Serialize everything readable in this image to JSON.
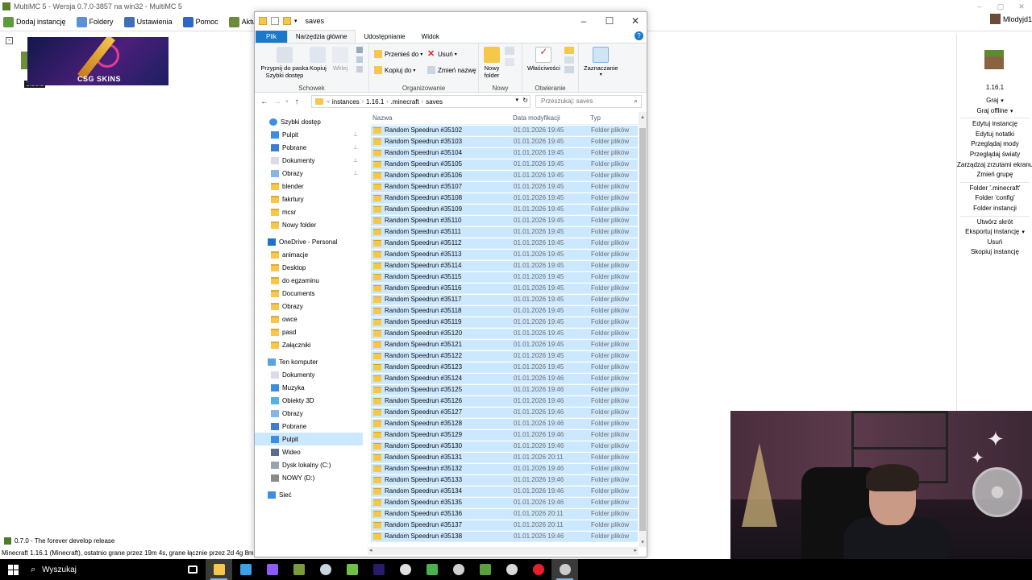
{
  "mmc": {
    "title": "MultiMC 5 - Wersja 0.7.0-3857 na win32 - MultiMC 5",
    "toolbar": [
      {
        "label": "Dodaj instancję",
        "icon": "add-instance-icon",
        "color": "#5c9a3c"
      },
      {
        "label": "Foldery",
        "icon": "folders-icon",
        "color": "#5b8fd6"
      },
      {
        "label": "Ustawienia",
        "icon": "settings-icon",
        "color": "#3f6fb5"
      },
      {
        "label": "Pomoc",
        "icon": "help-icon",
        "color": "#2f67c8"
      },
      {
        "label": "Aktualizuj",
        "icon": "update-icon",
        "color": "#6b8a3a"
      }
    ],
    "user": "Mlodyjd1",
    "instance_label": "1.16.1",
    "banner_text": "CSG SKINS",
    "right_panel": {
      "version": "1.16.1",
      "actions_top": [
        {
          "label": "Graj",
          "dropdown": true
        },
        {
          "label": "Graj offline",
          "dropdown": true
        }
      ],
      "actions_mid": [
        "Edytuj instancję",
        "Edytuj notatki",
        "Przeglądaj mody",
        "Przeglądaj światy",
        "Zarządzaj zrzutami ekranu",
        "Zmień grupę"
      ],
      "actions_folders": [
        "Folder '.minecraft'",
        "Folder 'config'",
        "Folder instancji"
      ],
      "actions_bottom": [
        {
          "label": "Utwórz skrót",
          "dropdown": false
        },
        {
          "label": "Eksportuj instancję",
          "dropdown": true
        },
        {
          "label": "Usuń",
          "dropdown": false
        },
        {
          "label": "Skopiuj instancję",
          "dropdown": false
        }
      ]
    },
    "news": "0.7.0 - The forever develop release",
    "status": "Minecraft 1.16.1 (Minecraft), ostatnio grane przez 19m 4s, grane łącznie przez 2d 4g 8m"
  },
  "explorer": {
    "title": "saves",
    "tabs": [
      "Plik",
      "Narzędzia główne",
      "Udostępnianie",
      "Widok"
    ],
    "ribbon": {
      "schowek": {
        "label": "Schowek",
        "pin": "Przypnij do paska Szybki dostęp",
        "copy": "Kopiuj",
        "paste": "Wklej"
      },
      "organizowanie": {
        "label": "Organizowanie",
        "move": "Przenieś do",
        "copy_to": "Kopiuj do",
        "delete": "Usuń",
        "rename": "Zmień nazwę"
      },
      "nowy": {
        "label": "Nowy",
        "new_folder": "Nowy folder"
      },
      "otwieranie": {
        "label": "Otwieranie",
        "properties": "Właściwości"
      },
      "zaznaczanie": {
        "label": "Zaznaczanie"
      }
    },
    "address": {
      "crumbs": [
        "instances",
        "1.16.1",
        ".minecraft",
        "saves"
      ],
      "search_placeholder": "Przeszukaj: saves"
    },
    "nav": {
      "quick_access": "Szybki dostęp",
      "quick_items": [
        {
          "label": "Pulpit",
          "pinned": true,
          "icon": "desktop"
        },
        {
          "label": "Pobrane",
          "pinned": true,
          "icon": "download"
        },
        {
          "label": "Dokumenty",
          "pinned": true,
          "icon": "docs"
        },
        {
          "label": "Obrazy",
          "pinned": true,
          "icon": "pictures"
        },
        {
          "label": "blender",
          "pinned": false,
          "icon": "folder"
        },
        {
          "label": "fakrtury",
          "pinned": false,
          "icon": "folder"
        },
        {
          "label": "mcsr",
          "pinned": false,
          "icon": "folder"
        },
        {
          "label": "Nowy folder",
          "pinned": false,
          "icon": "folder"
        }
      ],
      "onedrive": "OneDrive - Personal",
      "onedrive_items": [
        "animacje",
        "Desktop",
        "do egzaminu",
        "Documents",
        "Obrazy",
        "owce",
        "pasd",
        "Załączniki"
      ],
      "this_pc": "Ten komputer",
      "pc_items": [
        {
          "label": "Dokumenty",
          "icon": "docs",
          "selected": false
        },
        {
          "label": "Muzyka",
          "icon": "music",
          "selected": false
        },
        {
          "label": "Obiekty 3D",
          "icon": "objects3d",
          "selected": false
        },
        {
          "label": "Obrazy",
          "icon": "pictures",
          "selected": false
        },
        {
          "label": "Pobrane",
          "icon": "download",
          "selected": false
        },
        {
          "label": "Pulpit",
          "icon": "desktop",
          "selected": true
        },
        {
          "label": "Wideo",
          "icon": "video",
          "selected": false
        },
        {
          "label": "Dysk lokalny (C:)",
          "icon": "drive",
          "selected": false
        },
        {
          "label": "NOWY (D:)",
          "icon": "usb",
          "selected": false
        }
      ],
      "network": "Sieć"
    },
    "columns": {
      "name": "Nazwa",
      "date": "Data modyfikacji",
      "type": "Typ"
    },
    "files": [
      {
        "name": "Random Speedrun #35102",
        "date": "01.01.2026 19:45",
        "type": "Folder plików"
      },
      {
        "name": "Random Speedrun #35103",
        "date": "01.01.2026 19:45",
        "type": "Folder plików"
      },
      {
        "name": "Random Speedrun #35104",
        "date": "01.01.2026 19:45",
        "type": "Folder plików"
      },
      {
        "name": "Random Speedrun #35105",
        "date": "01.01.2026 19:45",
        "type": "Folder plików"
      },
      {
        "name": "Random Speedrun #35106",
        "date": "01.01.2026 19:45",
        "type": "Folder plików"
      },
      {
        "name": "Random Speedrun #35107",
        "date": "01.01.2026 19:45",
        "type": "Folder plików"
      },
      {
        "name": "Random Speedrun #35108",
        "date": "01.01.2026 19:45",
        "type": "Folder plików"
      },
      {
        "name": "Random Speedrun #35109",
        "date": "01.01.2026 19:45",
        "type": "Folder plików"
      },
      {
        "name": "Random Speedrun #35110",
        "date": "01.01.2026 19:45",
        "type": "Folder plików"
      },
      {
        "name": "Random Speedrun #35111",
        "date": "01.01.2026 19:45",
        "type": "Folder plików"
      },
      {
        "name": "Random Speedrun #35112",
        "date": "01.01.2026 19:45",
        "type": "Folder plików"
      },
      {
        "name": "Random Speedrun #35113",
        "date": "01.01.2026 19:45",
        "type": "Folder plików"
      },
      {
        "name": "Random Speedrun #35114",
        "date": "01.01.2026 19:45",
        "type": "Folder plików"
      },
      {
        "name": "Random Speedrun #35115",
        "date": "01.01.2026 19:45",
        "type": "Folder plików"
      },
      {
        "name": "Random Speedrun #35116",
        "date": "01.01.2026 19:45",
        "type": "Folder plików"
      },
      {
        "name": "Random Speedrun #35117",
        "date": "01.01.2026 19:45",
        "type": "Folder plików"
      },
      {
        "name": "Random Speedrun #35118",
        "date": "01.01.2026 19:45",
        "type": "Folder plików"
      },
      {
        "name": "Random Speedrun #35119",
        "date": "01.01.2026 19:45",
        "type": "Folder plików"
      },
      {
        "name": "Random Speedrun #35120",
        "date": "01.01.2026 19:45",
        "type": "Folder plików"
      },
      {
        "name": "Random Speedrun #35121",
        "date": "01.01.2026 19:45",
        "type": "Folder plików"
      },
      {
        "name": "Random Speedrun #35122",
        "date": "01.01.2026 19:45",
        "type": "Folder plików"
      },
      {
        "name": "Random Speedrun #35123",
        "date": "01.01.2026 19:45",
        "type": "Folder plików"
      },
      {
        "name": "Random Speedrun #35124",
        "date": "01.01.2026 19:46",
        "type": "Folder plików"
      },
      {
        "name": "Random Speedrun #35125",
        "date": "01.01.2026 19:46",
        "type": "Folder plików"
      },
      {
        "name": "Random Speedrun #35126",
        "date": "01.01.2026 19:46",
        "type": "Folder plików"
      },
      {
        "name": "Random Speedrun #35127",
        "date": "01.01.2026 19:46",
        "type": "Folder plików"
      },
      {
        "name": "Random Speedrun #35128",
        "date": "01.01.2026 19:46",
        "type": "Folder plików"
      },
      {
        "name": "Random Speedrun #35129",
        "date": "01.01.2026 19:46",
        "type": "Folder plików"
      },
      {
        "name": "Random Speedrun #35130",
        "date": "01.01.2026 19:46",
        "type": "Folder plików"
      },
      {
        "name": "Random Speedrun #35131",
        "date": "01.01.2026 20:11",
        "type": "Folder plików"
      },
      {
        "name": "Random Speedrun #35132",
        "date": "01.01.2026 19:46",
        "type": "Folder plików"
      },
      {
        "name": "Random Speedrun #35133",
        "date": "01.01.2026 19:46",
        "type": "Folder plików"
      },
      {
        "name": "Random Speedrun #35134",
        "date": "01.01.2026 19:46",
        "type": "Folder plików"
      },
      {
        "name": "Random Speedrun #35135",
        "date": "01.01.2026 19:46",
        "type": "Folder plików"
      },
      {
        "name": "Random Speedrun #35136",
        "date": "01.01.2026 20:11",
        "type": "Folder plików"
      },
      {
        "name": "Random Speedrun #35137",
        "date": "01.01.2026 20:11",
        "type": "Folder plików"
      },
      {
        "name": "Random Speedrun #35138",
        "date": "01.01.2026 19:46",
        "type": "Folder plików"
      }
    ]
  },
  "taskbar": {
    "search_label": "Wyszukaj",
    "apps": [
      {
        "icon": "task-view-icon",
        "color": "#ffffff",
        "active": false
      },
      {
        "icon": "file-explorer-icon",
        "color": "#f5c84c",
        "active": true
      },
      {
        "icon": "multimc-icon",
        "color": "#3fa0e8",
        "active": false
      },
      {
        "icon": "obsidian-icon",
        "color": "#8b5cf6",
        "active": false
      },
      {
        "icon": "minecraft-launcher-icon",
        "color": "#7a9a3c",
        "active": false
      },
      {
        "icon": "steam-icon",
        "color": "#c7d5e0",
        "active": false
      },
      {
        "icon": "notepad-icon",
        "color": "#6fbf4a",
        "active": false
      },
      {
        "icon": "premiere-icon",
        "color": "#2a1a6b",
        "active": false
      },
      {
        "icon": "settings-gear-icon",
        "color": "#e0e0e0",
        "active": false
      },
      {
        "icon": "minecraft-icon",
        "color": "#4caf50",
        "active": false
      },
      {
        "icon": "paint-icon",
        "color": "#cfcfcf",
        "active": false
      },
      {
        "icon": "book-icon",
        "color": "#5aa03c",
        "active": false
      },
      {
        "icon": "discord-icon",
        "color": "#d9d9d9",
        "active": false
      },
      {
        "icon": "opera-icon",
        "color": "#e5202e",
        "active": false
      },
      {
        "icon": "obs-icon",
        "color": "#cccccc",
        "active": true
      }
    ]
  }
}
